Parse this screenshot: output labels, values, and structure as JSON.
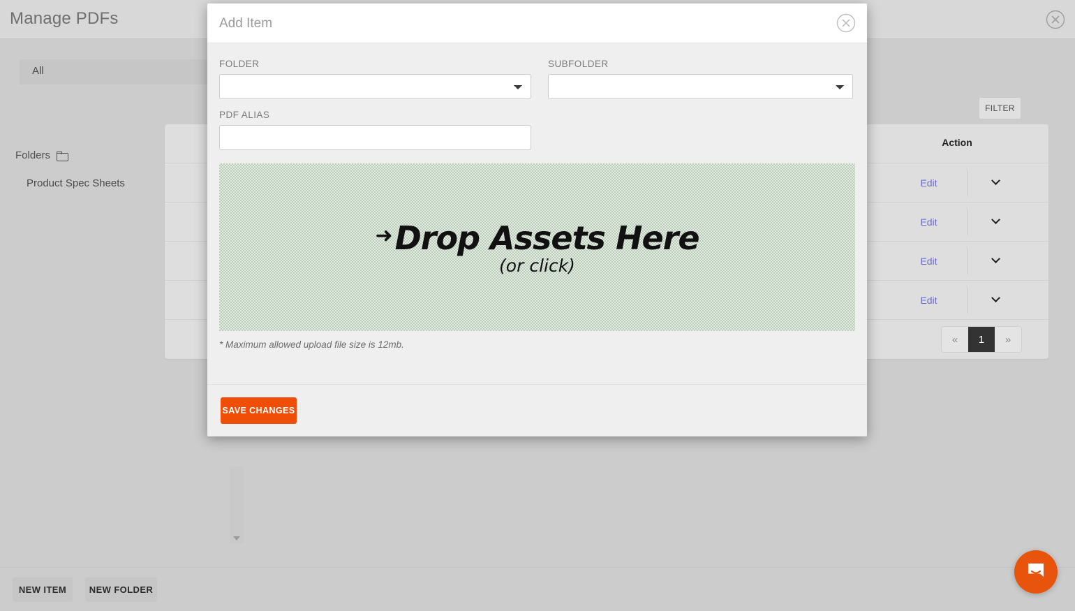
{
  "background": {
    "header": {
      "title": "Manage PDFs",
      "close_icon": "close-circle-icon"
    },
    "filter_select": {
      "value": "All"
    },
    "filter_button": {
      "label": "FILTER"
    },
    "folders": {
      "label": "Folders",
      "icon": "folder-icon",
      "items": [
        "Product Spec Sheets"
      ]
    },
    "table": {
      "columns": [
        "Action"
      ],
      "rows": [
        {
          "action_label": "Edit",
          "caret_icon": "chevron-down-icon"
        },
        {
          "action_label": "Edit",
          "caret_icon": "chevron-down-icon"
        },
        {
          "action_label": "Edit",
          "caret_icon": "chevron-down-icon"
        },
        {
          "action_label": "Edit",
          "caret_icon": "chevron-down-icon"
        }
      ],
      "pagination": {
        "first": "«",
        "pages": [
          "1"
        ],
        "last": "»",
        "current": "1"
      }
    },
    "footer": {
      "new_item": "NEW ITEM",
      "new_folder": "NEW FOLDER"
    },
    "chat_widget": {
      "icon": "intercom-chat-icon",
      "color": "#e8540c"
    }
  },
  "modal": {
    "title": "Add Item",
    "close_icon": "close-circle-icon",
    "fields": {
      "folder": {
        "label": "FOLDER",
        "value": "",
        "options": [
          ""
        ]
      },
      "subfolder": {
        "label": "SUBFOLDER",
        "value": "",
        "options": [
          ""
        ]
      },
      "pdf_alias": {
        "label": "PDF ALIAS",
        "value": "",
        "placeholder": ""
      }
    },
    "dropzone": {
      "arrow_icon": "right-arrow-icon",
      "main_text": "Drop Assets Here",
      "sub_text": "(or click)"
    },
    "note": "* Maximum allowed upload file size is 12mb.",
    "save_button": {
      "label": "SAVE CHANGES",
      "color": "#f04e06"
    }
  }
}
